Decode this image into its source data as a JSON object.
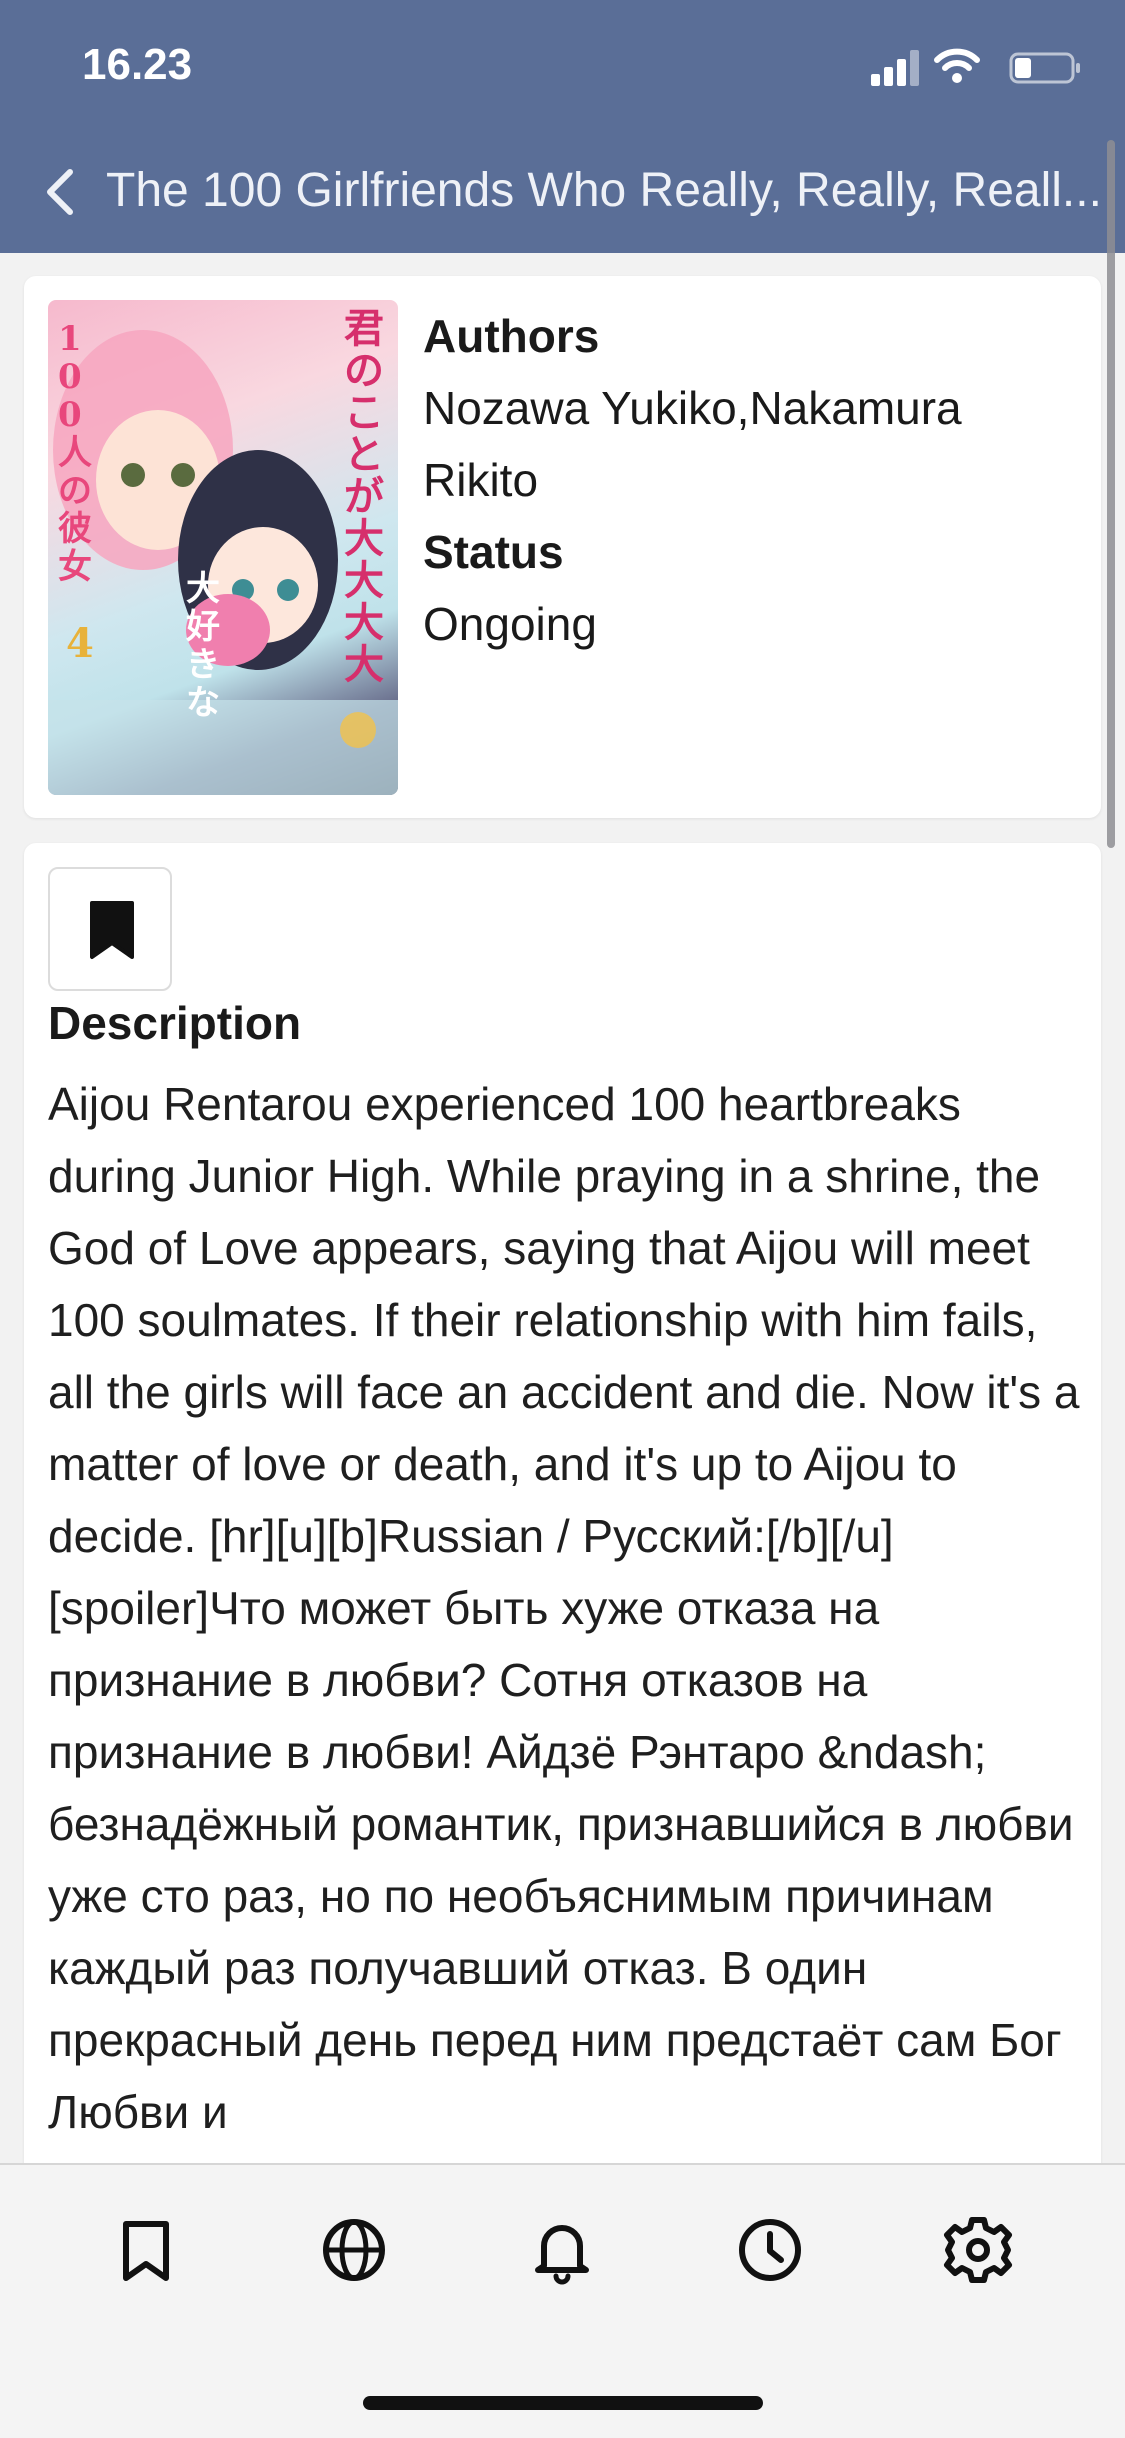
{
  "status_bar": {
    "time": "16.23"
  },
  "nav": {
    "title": "The 100 Girlfriends Who Really, Really, Reall..."
  },
  "info": {
    "authors_label": "Authors",
    "authors_value": "Nozawa Yukiko,Nakamura Rikito",
    "status_label": "Status",
    "status_value": "Ongoing"
  },
  "description": {
    "title": "Description",
    "text": "Aijou Rentarou experienced 100 heartbreaks during Junior High. While praying in a shrine, the God of Love appears, saying that Aijou will meet 100 soulmates. If their relationship with him fails, all the girls will face an accident and die. Now it's a matter of love or death, and it's up to Aijou to decide. [hr][u][b]Russian / Русский:[/b][/u] [spoiler]Что может быть хуже отказа на признание в любви? Сотня отказов на признание в любви! Айдзё Рэнтаро &ndash; безнадёжный романтик, признавшийся в любви уже сто раз, но по необъяснимым причинам каждый раз получавший отказ. В один прекрасный день перед ним предстаёт сам Бог Любви и"
  },
  "cover": {
    "vertical_title_right": "君のことが大大大大",
    "vertical_title_left": "100人の彼女",
    "badge": "大好きな",
    "volume": "4"
  },
  "tabs": [
    {
      "name": "library",
      "icon": "bookmark-icon"
    },
    {
      "name": "browse",
      "icon": "globe-icon"
    },
    {
      "name": "updates",
      "icon": "bell-icon"
    },
    {
      "name": "history",
      "icon": "clock-icon"
    },
    {
      "name": "settings",
      "icon": "gear-icon"
    }
  ],
  "colors": {
    "header": "#5a6e97",
    "background": "#f2f2f2",
    "card": "#ffffff"
  }
}
